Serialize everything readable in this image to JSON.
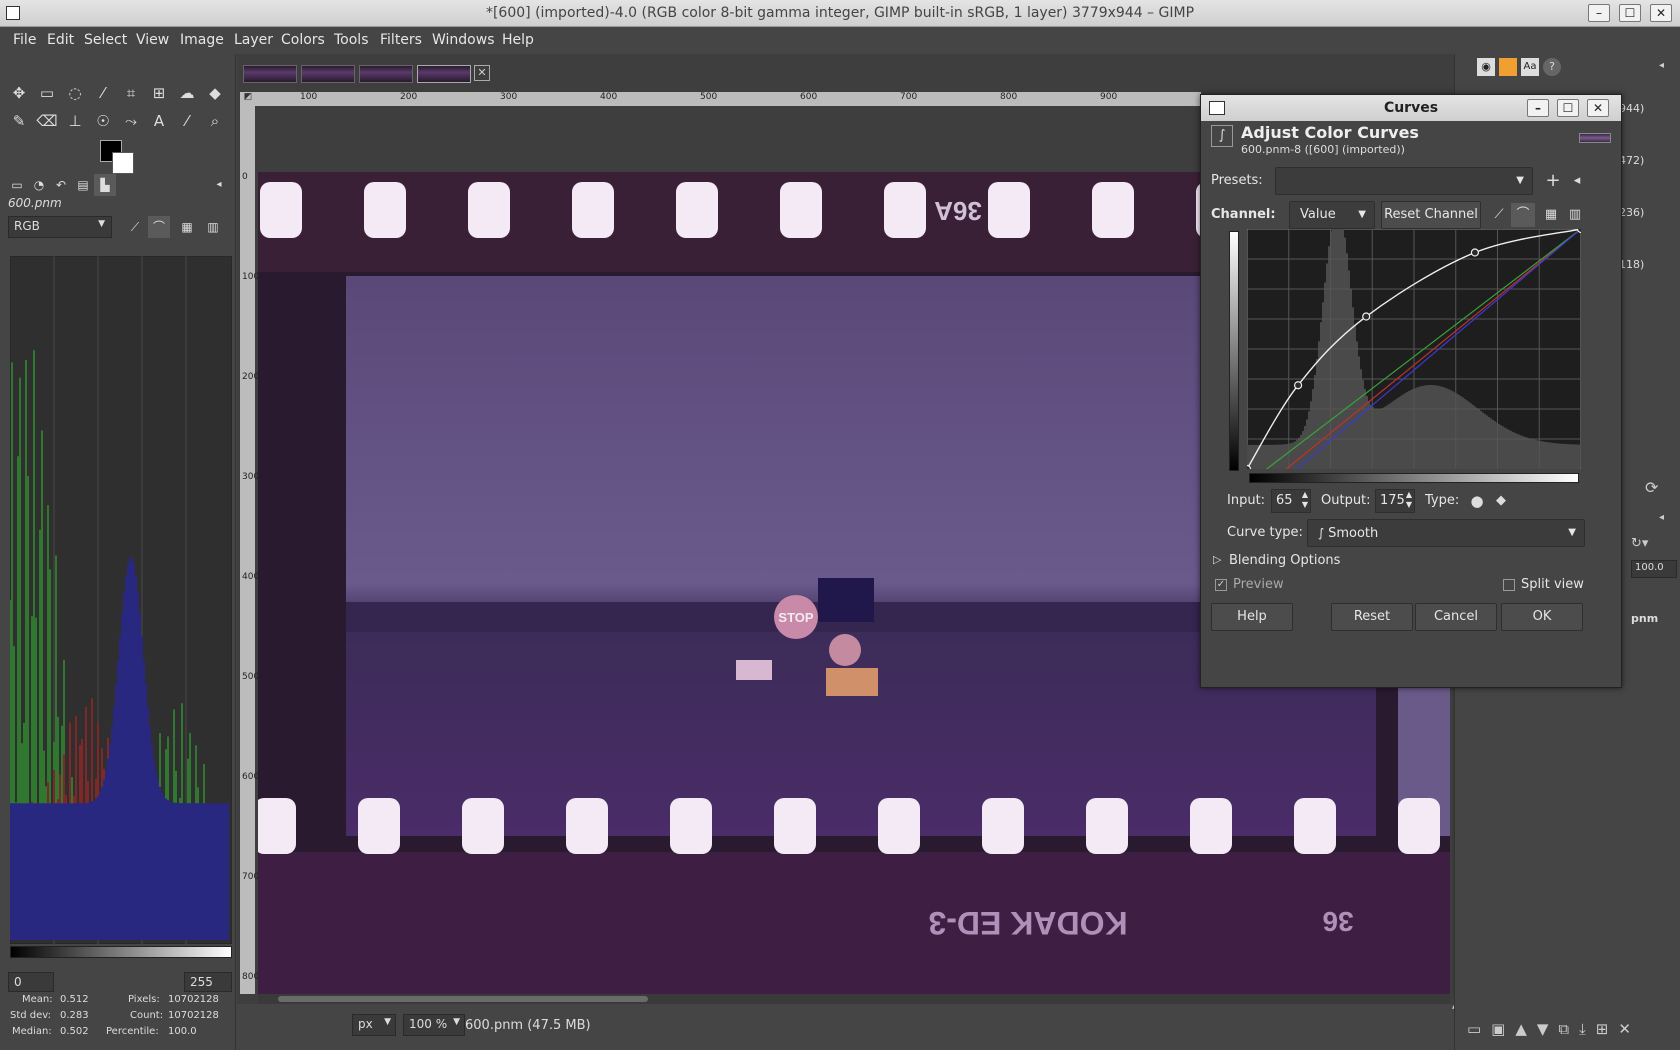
{
  "window": {
    "title": "*[600] (imported)-4.0 (RGB color 8-bit gamma integer, GIMP built-in sRGB, 1 layer) 3779x944 – GIMP",
    "minimize": "–",
    "maximize": "☐",
    "close": "✕"
  },
  "menu": [
    "File",
    "Edit",
    "Select",
    "View",
    "Image",
    "Layer",
    "Colors",
    "Tools",
    "Filters",
    "Windows",
    "Help"
  ],
  "histogram": {
    "image_name": "600.pnm",
    "channel": "RGB",
    "range_low": "0",
    "range_high": "255",
    "stats": {
      "mean_label": "Mean:",
      "mean": "0.512",
      "stddev_label": "Std dev:",
      "stddev": "0.283",
      "median_label": "Median:",
      "median": "0.502",
      "pixels_label": "Pixels:",
      "pixels": "10702128",
      "count_label": "Count:",
      "count": "10702128",
      "percentile_label": "Percentile:",
      "percentile": "100.0"
    }
  },
  "rulers": {
    "top": [
      "100",
      "200",
      "300",
      "400",
      "500",
      "600",
      "700",
      "800",
      "900"
    ],
    "left": [
      "0",
      "100",
      "200",
      "300",
      "400",
      "500",
      "600",
      "700",
      "800"
    ]
  },
  "photo": {
    "frame_number_top": "36A",
    "sign_text": "STOP",
    "edge_print": "KODAK ED-3",
    "frame_number_bottom": "36"
  },
  "status": {
    "unit": "px",
    "zoom": "100 %",
    "file_info": "600.pnm (47.5 MB)"
  },
  "right_dock": {
    "values": [
      "944)",
      "472)",
      "236)",
      "118)"
    ],
    "opacity": "100.0",
    "layer_name": "pnm"
  },
  "curves": {
    "window_title": "Curves",
    "heading": "Adjust Color Curves",
    "subheading": "600.pnm-8 ([600] (imported))",
    "presets_label": "Presets:",
    "presets_value": "",
    "channel_label": "Channel:",
    "channel_value": "Value",
    "reset_channel": "Reset Channel",
    "input_label": "Input:",
    "input_value": "65",
    "output_label": "Output:",
    "output_value": "175",
    "type_label": "Type:",
    "curve_type_label": "Curve type:",
    "curve_type_value": "Smooth",
    "blending_options": "Blending Options",
    "preview_label": "Preview",
    "split_view_label": "Split view",
    "btn_help": "Help",
    "btn_reset": "Reset",
    "btn_cancel": "Cancel",
    "btn_ok": "OK",
    "value_curve_points": [
      [
        0,
        0
      ],
      [
        39,
        89
      ],
      [
        91,
        162
      ],
      [
        174,
        230
      ],
      [
        255,
        255
      ]
    ],
    "colors": {
      "red": "#c03030",
      "green": "#3aa03a",
      "blue": "#3a3ad0",
      "value": "#eeeeee"
    }
  },
  "colors": {
    "fg": "#000000",
    "bg": "#ffffff",
    "film_purple": "#5e4a7e"
  }
}
